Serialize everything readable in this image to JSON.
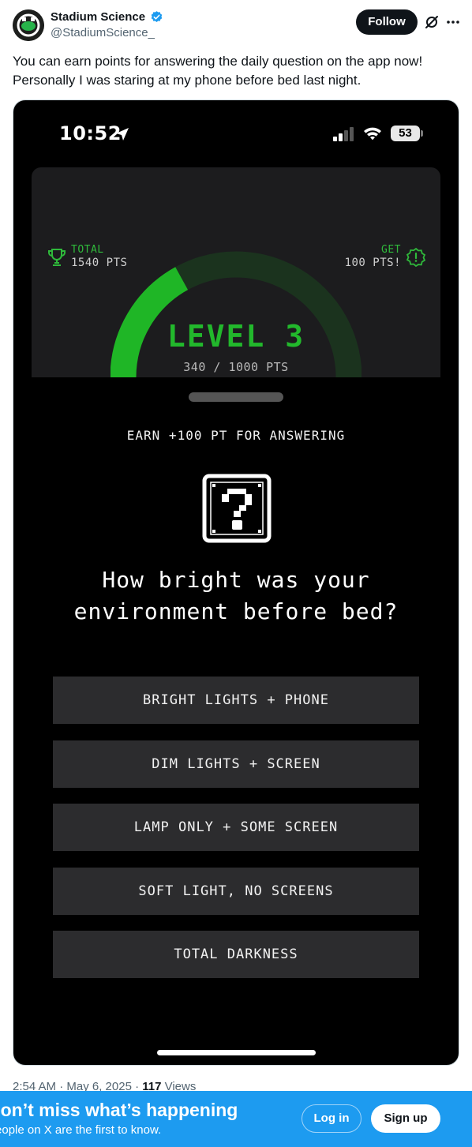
{
  "tweet": {
    "author_name": "Stadium Science",
    "handle": "@StadiumScience_",
    "follow_label": "Follow",
    "text": "You can earn points for answering the daily question on the app now! Personally I was staring at my phone before bed last night.",
    "timestamp": "2:54 AM · May 6, 2025 · ",
    "views_count": "117",
    "views_label": " Views"
  },
  "phone": {
    "status_time": "10:52",
    "battery": "53",
    "total_label": "TOTAL",
    "total_pts": "1540 PTS",
    "get_label": "GET",
    "get_pts": "100 PTS!",
    "level": "LEVEL 3",
    "progress": "340 / 1000 PTS",
    "progress_fraction": 0.34,
    "earn_text": "EARN +100 PT FOR ANSWERING",
    "question_line1": "How bright was your",
    "question_line2": "environment before bed?",
    "options": [
      "BRIGHT LIGHTS + PHONE",
      "DIM LIGHTS + SCREEN",
      "LAMP ONLY + SOME SCREEN",
      "SOFT LIGHT, NO SCREENS",
      "TOTAL DARKNESS"
    ]
  },
  "banner": {
    "title": "Don’t miss what’s happening",
    "subtitle": "People on X are the first to know.",
    "login_label": "Log in",
    "signup_label": "Sign up"
  },
  "colors": {
    "accent": "#1d9bf0",
    "level_green": "#22b82c",
    "gauge_track": "#1b331e"
  }
}
